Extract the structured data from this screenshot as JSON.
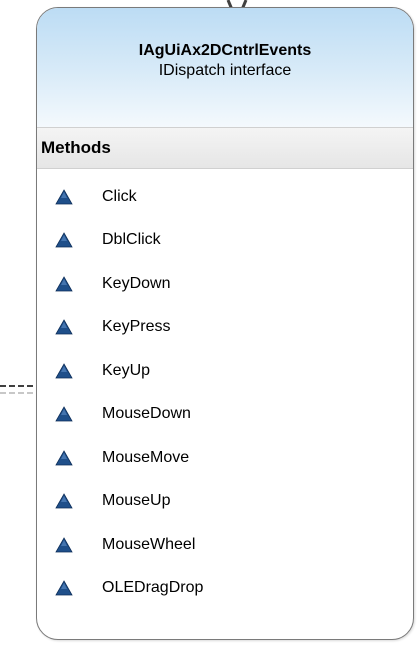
{
  "class": {
    "name": "IAgUiAx2DCntrlEvents",
    "kind": "IDispatch interface"
  },
  "section": {
    "title": "Methods"
  },
  "methods": [
    {
      "label": "Click",
      "icon": "method-triangle-icon"
    },
    {
      "label": "DblClick",
      "icon": "method-triangle-icon"
    },
    {
      "label": "KeyDown",
      "icon": "method-triangle-icon"
    },
    {
      "label": "KeyPress",
      "icon": "method-triangle-icon"
    },
    {
      "label": "KeyUp",
      "icon": "method-triangle-icon"
    },
    {
      "label": "MouseDown",
      "icon": "method-triangle-icon"
    },
    {
      "label": "MouseMove",
      "icon": "method-triangle-icon"
    },
    {
      "label": "MouseUp",
      "icon": "method-triangle-icon"
    },
    {
      "label": "MouseWheel",
      "icon": "method-triangle-icon"
    },
    {
      "label": "OLEDragDrop",
      "icon": "method-triangle-icon"
    }
  ],
  "colors": {
    "header_gradient_top": "#bcdcf4",
    "icon_fill": "#1f4f8a",
    "border": "#7a7a7a"
  }
}
